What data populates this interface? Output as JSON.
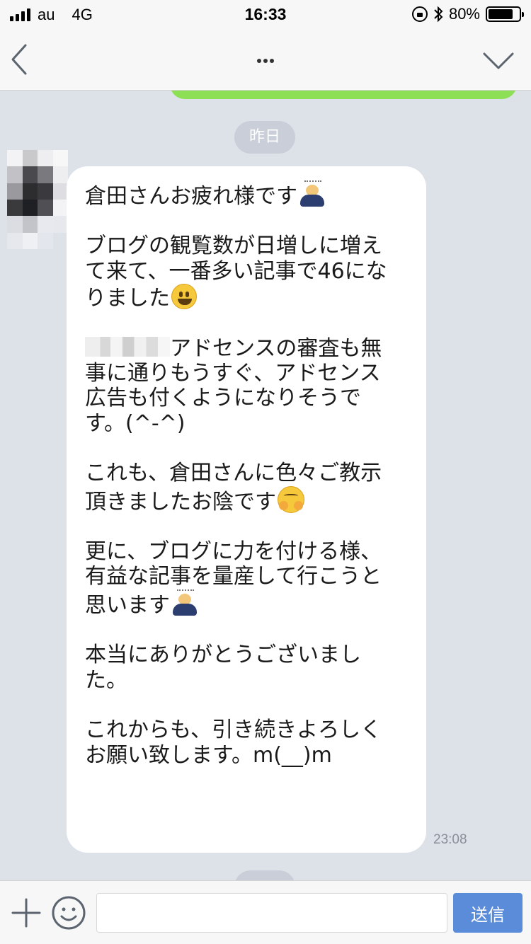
{
  "status_bar": {
    "carrier": "au",
    "network": "4G",
    "time": "16:33",
    "battery": "80%",
    "battery_level": 0.8,
    "signal_bars": 4
  },
  "nav": {
    "more": "…",
    "back_icon": "chevron-left-icon",
    "dropdown_icon": "chevron-down-icon"
  },
  "chat": {
    "date_divider": "昨日",
    "message": {
      "p1": "倉田さんお疲れ様です",
      "p2_line1": "ブログの観覧数が日増しに増え",
      "p2_line2": "て来て、一番多い記事で46にな",
      "p2_line3": "りました",
      "p3_line1": "アドセンスの審査も無",
      "p3_line2": "事に通りもうすぐ、アドセンス",
      "p3_line3": "広告も付くようになりそうで",
      "p3_line4": "す。(^-^)",
      "p4_line1": "これも、倉田さんに色々ご教示",
      "p4_line2": "頂きましたお陰です",
      "p5_line1": "更に、ブログに力を付ける様、",
      "p5_line2": "有益な記事を量産して行こうと",
      "p5_line3": "思います",
      "p6_line1": "本当にありがとうございまし",
      "p6_line2": "た。",
      "p7_line1": "これからも、引き続きよろしく",
      "p7_line2": "お願い致します。m(__)m"
    },
    "timestamp": "23:08"
  },
  "input_bar": {
    "placeholder": "",
    "send_label": "送信"
  },
  "colors": {
    "bg": "#dde1e8",
    "bubble": "#ffffff",
    "own_bubble": "#8de055",
    "send_button": "#5b8cd9"
  }
}
